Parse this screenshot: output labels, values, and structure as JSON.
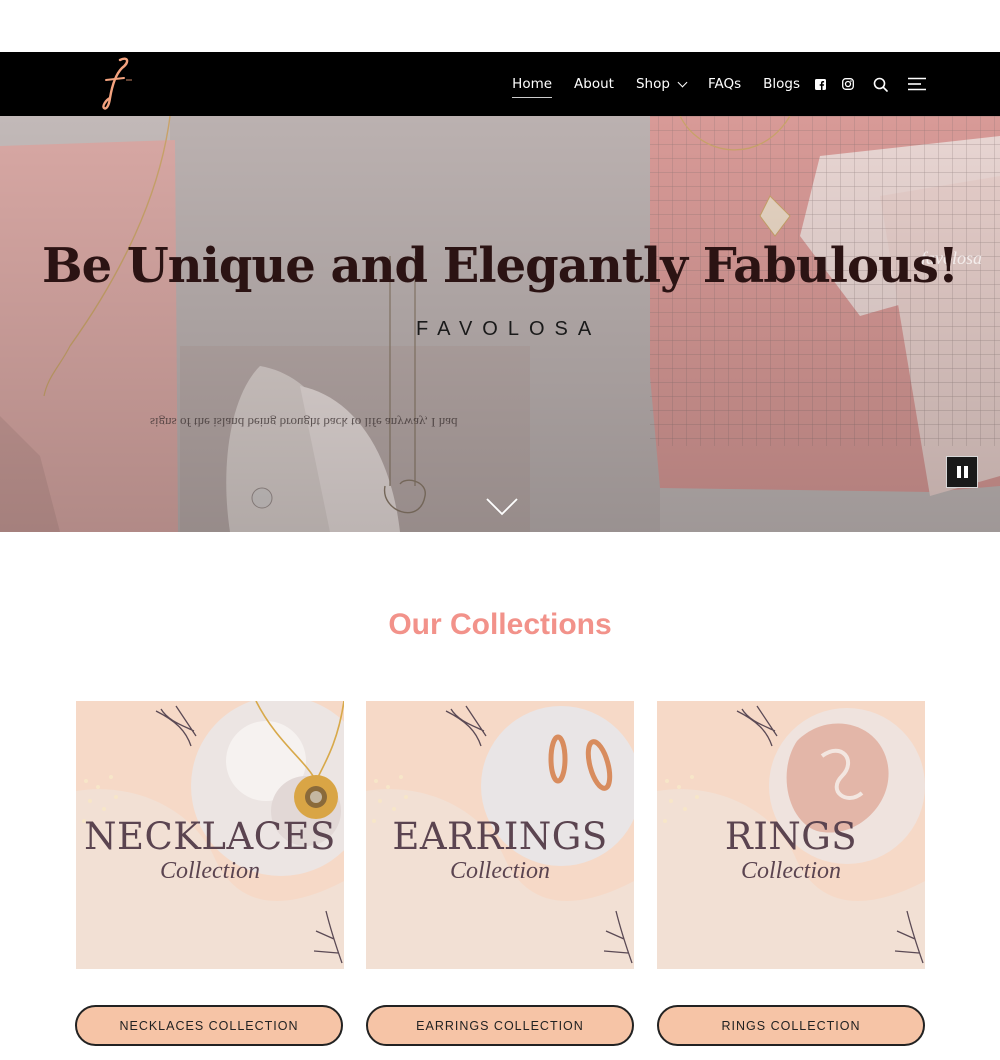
{
  "header": {
    "logo_icon": "favolosa-f-logo",
    "nav": [
      {
        "label": "Home",
        "active": true
      },
      {
        "label": "About"
      },
      {
        "label": "Shop",
        "has_dropdown": true
      },
      {
        "label": "FAQs"
      },
      {
        "label": "Blogs"
      }
    ],
    "icons": [
      "facebook-icon",
      "instagram-icon",
      "search-icon",
      "menu-icon"
    ]
  },
  "hero": {
    "title": "Be Unique and Elegantly Fabulous!",
    "subtitle": "FAVOLOSA",
    "background_text": "signs of the island being brought back to life anyway, I had",
    "watermark": "favolosa",
    "scroll_icon": "chevron-down-icon",
    "pause_icon": "pause-icon"
  },
  "collections": {
    "heading": "Our Collections",
    "items": [
      {
        "title": "NECKLACES",
        "script": "Collection",
        "button": "NECKLACES COLLECTION"
      },
      {
        "title": "EARRINGS",
        "script": "Collection",
        "button": "EARRINGS COLLECTION"
      },
      {
        "title": "RINGS",
        "script": "Collection",
        "button": "RINGS COLLECTION"
      }
    ]
  },
  "colors": {
    "header_bg": "#000000",
    "accent_heading": "#f2928a",
    "button_bg": "#f6c4a6",
    "card_bg": "#f6d9c7",
    "hero_title": "#2b1313"
  }
}
